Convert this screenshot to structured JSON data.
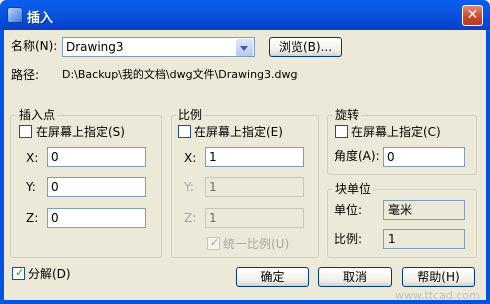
{
  "window": {
    "title": "插入",
    "close_symbol": "✕"
  },
  "name_row": {
    "label": "名称(N):",
    "value": "Drawing3",
    "browse": "浏览(B)..."
  },
  "path_row": {
    "label": "路径:",
    "value": "D:\\Backup\\我的文档\\dwg文件\\Drawing3.dwg"
  },
  "insertion": {
    "title": "插入点",
    "onscreen": "在屏幕上指定(S)",
    "x_label": "X:",
    "x": "0",
    "y_label": "Y:",
    "y": "0",
    "z_label": "Z:",
    "z": "0"
  },
  "scale": {
    "title": "比例",
    "onscreen": "在屏幕上指定(E)",
    "x_label": "X:",
    "x": "1",
    "y_label": "Y:",
    "y": "1",
    "z_label": "Z:",
    "z": "1",
    "uniform": "统一比例(U)",
    "uniform_checked": true
  },
  "rotation": {
    "title": "旋转",
    "onscreen": "在屏幕上指定(C)",
    "angle_label": "角度(A):",
    "angle": "0"
  },
  "block_unit": {
    "title": "块单位",
    "unit_label": "单位:",
    "unit": "毫米",
    "factor_label": "比例:",
    "factor": "1"
  },
  "explode": {
    "label": "分解(D)",
    "checked": true
  },
  "buttons": {
    "ok": "确定",
    "cancel": "取消",
    "help": "帮助(H)"
  },
  "watermark": "www.ttcad.com"
}
